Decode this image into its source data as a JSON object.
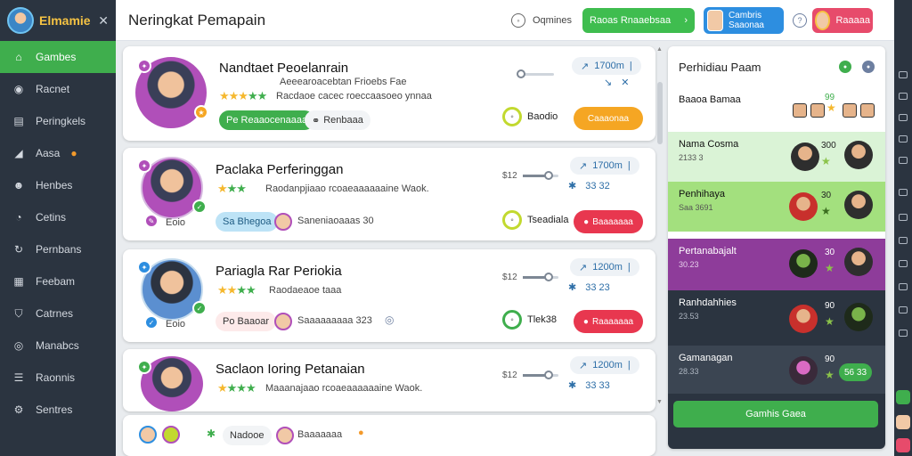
{
  "brand": {
    "name": "Elmamie"
  },
  "page_title": "Neringkat Pemapain",
  "sidebar": {
    "items": [
      {
        "label": "Gambes",
        "icon": "home-icon",
        "active": true
      },
      {
        "label": "Racnet",
        "icon": "location-icon"
      },
      {
        "label": "Peringkels",
        "icon": "chart-icon"
      },
      {
        "label": "Aasa",
        "icon": "megaphone-icon"
      },
      {
        "label": "Henbes",
        "icon": "user-icon"
      },
      {
        "label": "Cetins",
        "icon": "chat-icon"
      },
      {
        "label": "Pernbans",
        "icon": "refresh-icon"
      },
      {
        "label": "Feebam",
        "icon": "document-icon"
      },
      {
        "label": "Catrnes",
        "icon": "shield-icon"
      },
      {
        "label": "Manabcs",
        "icon": "globe-icon"
      },
      {
        "label": "Raonnis",
        "icon": "list-icon"
      },
      {
        "label": "Sentres",
        "icon": "gear-icon"
      }
    ]
  },
  "topbar": {
    "settings": "Oqmines",
    "action_label": "Raoas Rnaaebsaa",
    "user_name": "Cambris Saaonaa",
    "pink_label": "Raaaaa"
  },
  "cards": [
    {
      "title": "Nandtaet Peoelanrain",
      "subtitle": "Aeeearoacebtan Frioebs Fae",
      "desc": "Racdaoe cacec roeccaasoeo ynnaa",
      "chip1": "Pe Reaaocenaaaa",
      "chip2": "Renbaaa",
      "slider": "",
      "stat": "1700m",
      "icons": "",
      "status": "Baodio",
      "action": "Caaaonaa",
      "action_color": "#f5a623",
      "rating": 4
    },
    {
      "title": "Paclaka Perferinggan",
      "subtitle": "",
      "desc": "Raodanpjiaao rcoaeaaaaaaine Waok.",
      "chip1": "Sa Bhegoa",
      "chip2": "Saneniaoaaas 30",
      "slider": "$12",
      "stat": "1700m",
      "icons": "33 32",
      "status": "Tseadiala",
      "action": "Baaaaaaa",
      "action_color": "#e8374f",
      "rating": 3
    },
    {
      "title": "Pariagla Rar Periokia",
      "subtitle": "",
      "desc": "Raodaeaoe taaa",
      "chip1": "Po Baaoar",
      "chip2": "Saaaaaaaaa 323",
      "slider": "$12",
      "stat": "1200m",
      "icons": "33 23",
      "status": "Tlek38",
      "action": "Raaaaaaa",
      "action_color": "#e8374f",
      "rating": 4
    },
    {
      "title": "Saclaon Ioring Petanaian",
      "subtitle": "",
      "desc": "Maaanajaao rcoaeaaaaaaine Waok.",
      "chip1": "Nadooe",
      "chip2": "Baaaaaaa",
      "slider": "$12",
      "stat": "1200m",
      "icons": "33 33",
      "status": "",
      "action": "",
      "action_color": "#f5a623",
      "rating": 4
    }
  ],
  "right_panel": {
    "title": "Perhidiau Paam",
    "footer": "Gamhis Gaea",
    "rows": [
      {
        "name": "Baaoa Bamaa",
        "sub": "",
        "n1": "99",
        "n2": "99",
        "bg": "#ffffff"
      },
      {
        "name": "Nama Cosma",
        "sub": "2133 3",
        "n1": "300",
        "n2": "",
        "bg": "#daf3d6"
      },
      {
        "name": "Penhihaya",
        "sub": "Saa 3691",
        "n1": "30",
        "n2": "",
        "bg": "#a3e07e"
      },
      {
        "name": "Pertanabajalt",
        "sub": "30.23",
        "n1": "30",
        "n2": "",
        "bg": "#8e3c9a"
      },
      {
        "name": "Ranhdahhies",
        "sub": "23.53",
        "n1": "90",
        "n2": "",
        "bg": "#2b3440"
      },
      {
        "name": "Gamanagan",
        "sub": "28.33",
        "n1": "90",
        "n2": "56 33",
        "bg": "#3b4552"
      }
    ]
  }
}
